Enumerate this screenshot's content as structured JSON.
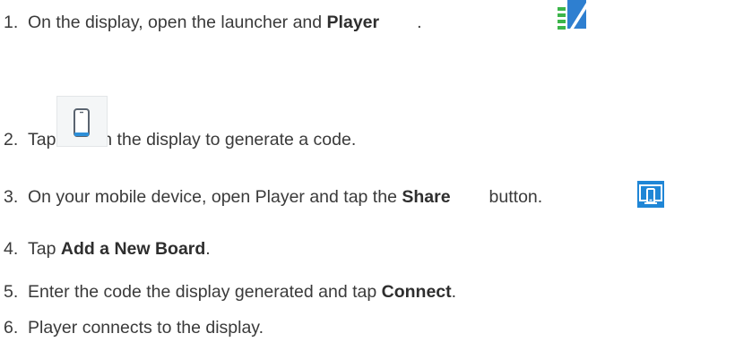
{
  "steps": [
    {
      "number": "1.",
      "text_before": "On the display, open the launcher and ",
      "bold": "Player",
      "text_after": ".",
      "icon": "player-app-icon"
    },
    {
      "number": "2.",
      "text_before": "Tap",
      "text_after": "on the display to generate a code.",
      "icon": "mobile-device-icon"
    },
    {
      "number": "3.",
      "text_before": "On your mobile device, open Player and tap the ",
      "bold": "Share",
      "text_after": "button.",
      "icon": "share-screen-icon"
    },
    {
      "number": "4.",
      "text_before": "Tap ",
      "bold": "Add a New Board",
      "text_after": "."
    },
    {
      "number": "5.",
      "text_before": "Enter the code the display generated and tap ",
      "bold": "Connect",
      "text_after": "."
    },
    {
      "number": "6.",
      "text_before": "Player connects to the display."
    }
  ],
  "colors": {
    "text": "#3a3a3a",
    "player_icon_blue": "#2e7fd0",
    "player_icon_green": "#3cb54a",
    "share_icon_blue": "#1f86d6"
  }
}
